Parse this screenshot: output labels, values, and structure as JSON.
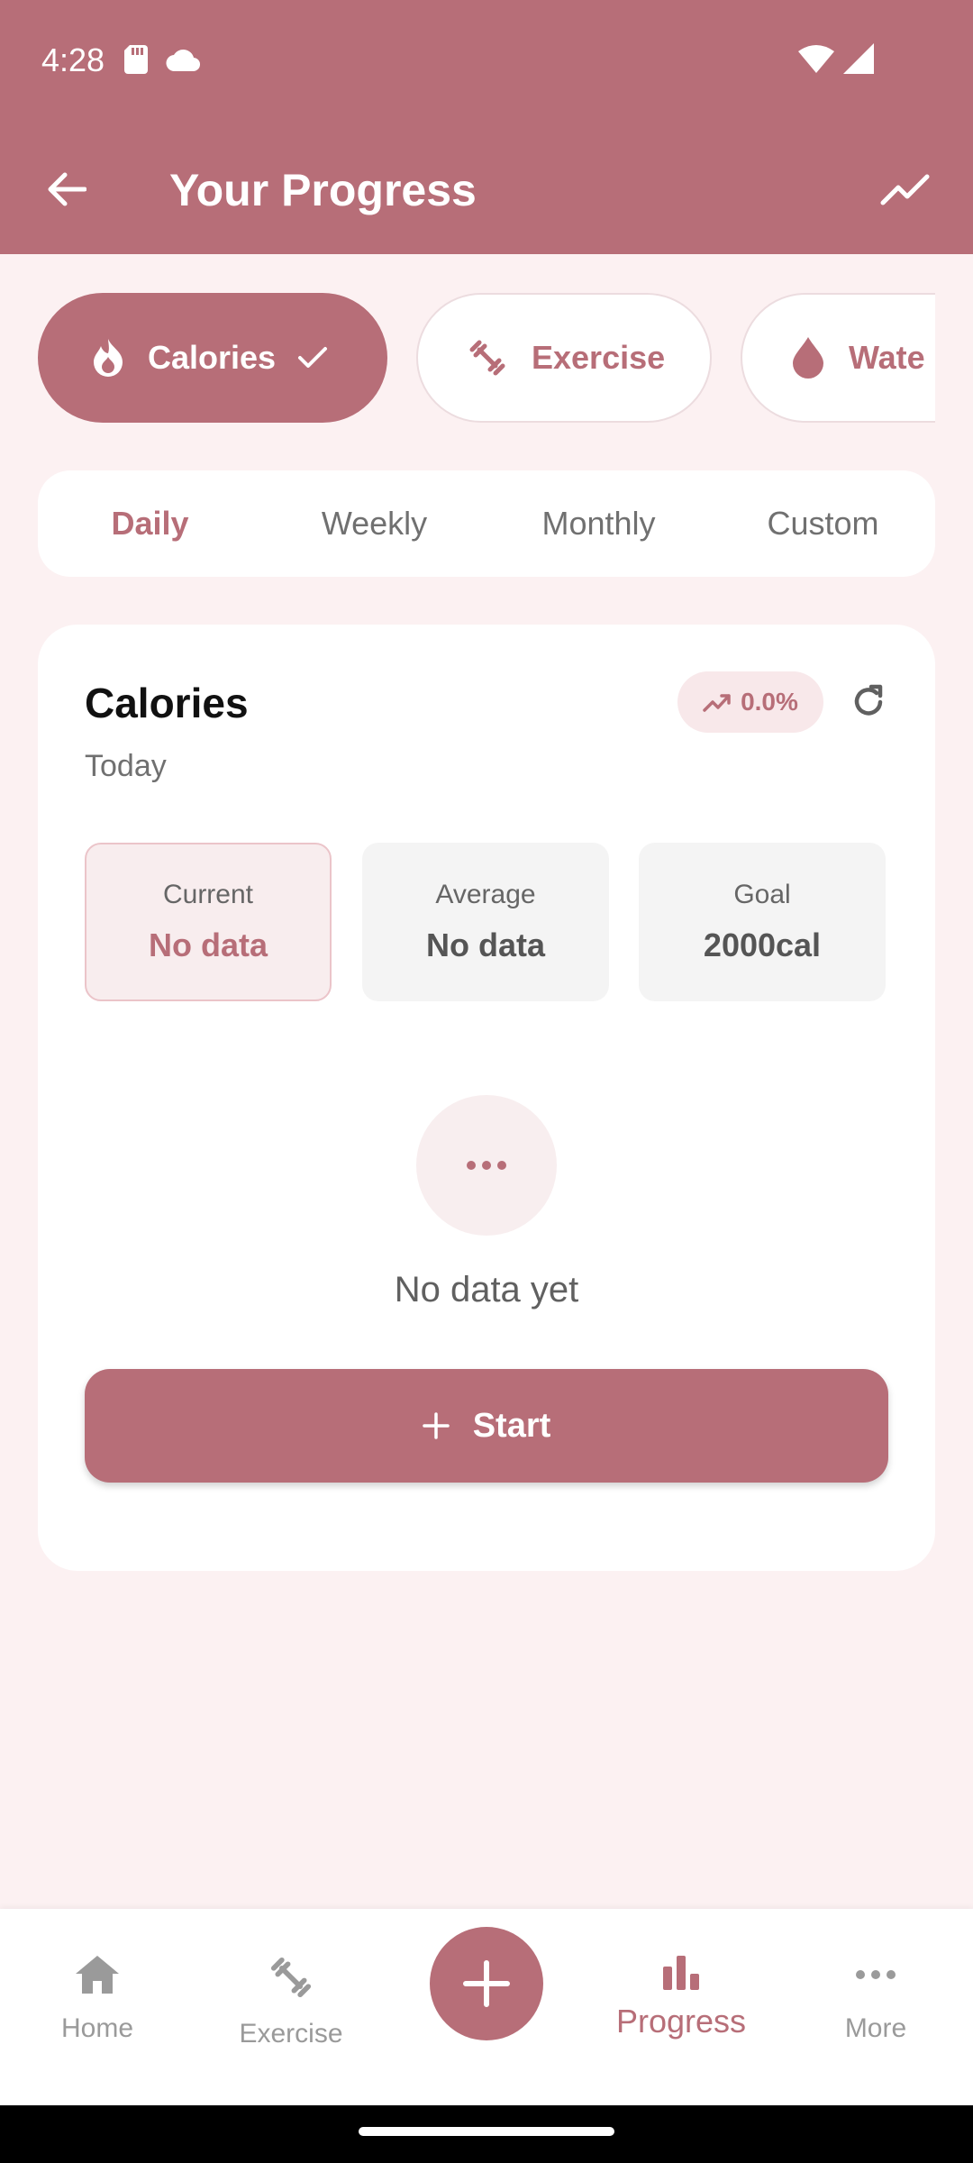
{
  "status_bar": {
    "time": "4:28"
  },
  "header": {
    "title": "Your Progress"
  },
  "categories": [
    {
      "label": "Calories",
      "selected": true
    },
    {
      "label": "Exercise",
      "selected": false
    },
    {
      "label": "Wate",
      "selected": false
    }
  ],
  "period_tabs": [
    {
      "label": "Daily",
      "active": true
    },
    {
      "label": "Weekly",
      "active": false
    },
    {
      "label": "Monthly",
      "active": false
    },
    {
      "label": "Custom",
      "active": false
    }
  ],
  "card": {
    "title": "Calories",
    "subtitle": "Today",
    "trend": "0.0%",
    "stats": [
      {
        "label": "Current",
        "value": "No data"
      },
      {
        "label": "Average",
        "value": "No data"
      },
      {
        "label": "Goal",
        "value": "2000cal"
      }
    ],
    "empty_text": "No data yet",
    "start_label": "Start"
  },
  "nav": [
    {
      "label": "Home",
      "icon": "home-icon"
    },
    {
      "label": "Exercise",
      "icon": "dumbbell-icon"
    },
    {
      "label": "Progress",
      "icon": "bar-chart-icon",
      "active": true
    },
    {
      "label": "More",
      "icon": "more-horiz-icon"
    }
  ],
  "colors": {
    "primary": "#b76e78",
    "background": "#fcf1f2",
    "surface": "#ffffff"
  }
}
